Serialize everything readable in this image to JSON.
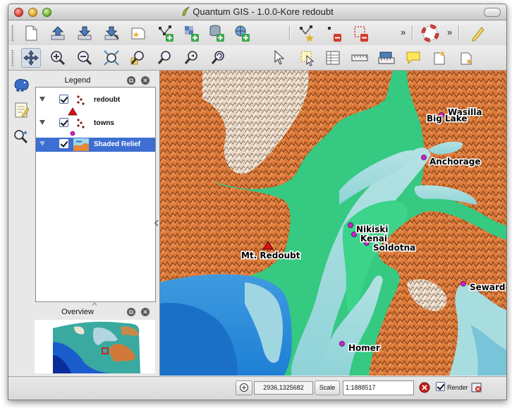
{
  "window": {
    "title": "Quantum GIS - 1.0.0-Kore  redoubt"
  },
  "legend": {
    "title": "Legend",
    "layers": [
      {
        "name": "redoubt",
        "checked": true,
        "selected": false
      },
      {
        "name": "towns",
        "checked": true,
        "selected": false
      },
      {
        "name": "Shaded Relief",
        "checked": true,
        "selected": true
      }
    ]
  },
  "overview": {
    "title": "Overview"
  },
  "map": {
    "places": [
      {
        "name": "Wasilla",
        "kind": "town"
      },
      {
        "name": "Big Lake",
        "kind": "town"
      },
      {
        "name": "Anchorage",
        "kind": "town"
      },
      {
        "name": "Nikiski",
        "kind": "town"
      },
      {
        "name": "Kenai",
        "kind": "town"
      },
      {
        "name": "Soldotna",
        "kind": "town"
      },
      {
        "name": "Mt. Redoubt",
        "kind": "volcano"
      },
      {
        "name": "Seward",
        "kind": "town"
      },
      {
        "name": "Homer",
        "kind": "town"
      }
    ],
    "colors": {
      "water_deep": "#1e7fd4",
      "water_shallow": "#a6dfe0",
      "lowland": "#2fcc80",
      "upland": "#e07a3a",
      "snow": "#f5f5f5",
      "town_marker": "#cc22cc",
      "volcano_marker": "#dd1111"
    }
  },
  "status": {
    "coordinates": "2936,1325682",
    "scale_label": "Scale",
    "scale_value": "1:1888517",
    "render_label": "Render",
    "render_checked": true
  },
  "icons": {
    "toolbar1": [
      "new-project-icon",
      "open-project-icon",
      "save-project-icon",
      "save-as-icon",
      "new-print-composer-icon",
      "add-vector-layer-icon",
      "add-raster-layer-icon",
      "add-postgis-layer-icon",
      "add-wms-layer-icon",
      "capture-point-icon",
      "delete-feature-icon",
      "cut-features-icon",
      "help-icon",
      "edit-pencil-icon"
    ],
    "toolbar2": [
      "pan-icon",
      "zoom-in-icon",
      "zoom-out-icon",
      "zoom-full-icon",
      "zoom-to-selection-icon",
      "zoom-to-layer-icon",
      "zoom-last-icon",
      "refresh-icon",
      "identify-icon",
      "select-features-icon",
      "attribute-table-icon",
      "measure-line-icon",
      "measure-area-icon",
      "map-tips-icon",
      "new-bookmark-icon",
      "show-bookmarks-icon"
    ],
    "sidebar": [
      "plugin-elephant-icon",
      "notepad-icon",
      "search-magnifier-icon"
    ]
  }
}
